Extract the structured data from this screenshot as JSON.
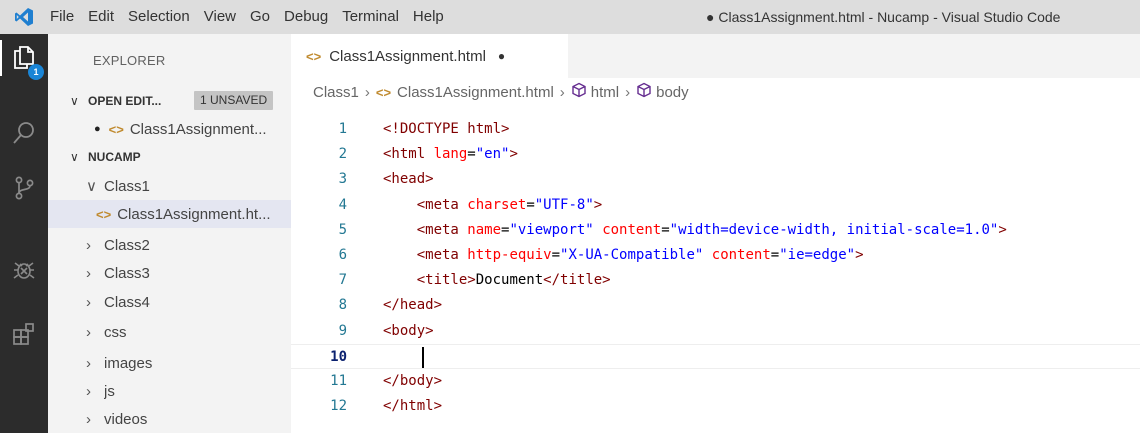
{
  "menu": [
    "File",
    "Edit",
    "Selection",
    "View",
    "Go",
    "Debug",
    "Terminal",
    "Help"
  ],
  "window_title": "● Class1Assignment.html - Nucamp - Visual Studio Code",
  "activity": {
    "explorer_badge": "1"
  },
  "sidebar": {
    "title": "EXPLORER",
    "open_editors": {
      "label": "OPEN EDIT...",
      "badge": "1 UNSAVED",
      "files": [
        {
          "name": "Class1Assignment..."
        }
      ]
    },
    "workspace": {
      "label": "NUCAMP",
      "class1": "Class1",
      "class1_file": "Class1Assignment.ht...",
      "folders": [
        "Class2",
        "Class3",
        "Class4",
        "css",
        "images",
        "js",
        "videos"
      ]
    }
  },
  "editor": {
    "tab_label": "Class1Assignment.html",
    "breadcrumbs": {
      "folder": "Class1",
      "file": "Class1Assignment.html",
      "html": "html",
      "body": "body"
    },
    "active_line": 10,
    "lines": [
      {
        "num": "1",
        "tokens": [
          [
            "t-tag",
            "<!DOCTYPE html>"
          ]
        ]
      },
      {
        "num": "2",
        "tokens": [
          [
            "t-tag",
            "<html "
          ],
          [
            "t-attr",
            "lang"
          ],
          [
            "t-plain",
            "="
          ],
          [
            "t-val",
            "\"en\""
          ],
          [
            "t-tag",
            ">"
          ]
        ]
      },
      {
        "num": "3",
        "tokens": [
          [
            "t-tag",
            "<head>"
          ]
        ]
      },
      {
        "num": "4",
        "tokens": [
          [
            "t-plain",
            "    "
          ],
          [
            "t-tag",
            "<meta "
          ],
          [
            "t-attr",
            "charset"
          ],
          [
            "t-plain",
            "="
          ],
          [
            "t-val",
            "\"UTF-8\""
          ],
          [
            "t-tag",
            ">"
          ]
        ]
      },
      {
        "num": "5",
        "tokens": [
          [
            "t-plain",
            "    "
          ],
          [
            "t-tag",
            "<meta "
          ],
          [
            "t-attr",
            "name"
          ],
          [
            "t-plain",
            "="
          ],
          [
            "t-val",
            "\"viewport\""
          ],
          [
            "t-plain",
            " "
          ],
          [
            "t-attr",
            "content"
          ],
          [
            "t-plain",
            "="
          ],
          [
            "t-val",
            "\"width=device-width, initial-scale=1.0\""
          ],
          [
            "t-tag",
            ">"
          ]
        ]
      },
      {
        "num": "6",
        "tokens": [
          [
            "t-plain",
            "    "
          ],
          [
            "t-tag",
            "<meta "
          ],
          [
            "t-attr",
            "http-equiv"
          ],
          [
            "t-plain",
            "="
          ],
          [
            "t-val",
            "\"X-UA-Compatible\""
          ],
          [
            "t-plain",
            " "
          ],
          [
            "t-attr",
            "content"
          ],
          [
            "t-plain",
            "="
          ],
          [
            "t-val",
            "\"ie=edge\""
          ],
          [
            "t-tag",
            ">"
          ]
        ]
      },
      {
        "num": "7",
        "tokens": [
          [
            "t-plain",
            "    "
          ],
          [
            "t-tag",
            "<title>"
          ],
          [
            "t-plain",
            "Document"
          ],
          [
            "t-tag",
            "</title>"
          ]
        ]
      },
      {
        "num": "8",
        "tokens": [
          [
            "t-tag",
            "</head>"
          ]
        ]
      },
      {
        "num": "9",
        "tokens": [
          [
            "t-tag",
            "<body>"
          ]
        ]
      },
      {
        "num": "10",
        "tokens": []
      },
      {
        "num": "11",
        "tokens": [
          [
            "t-tag",
            "</body>"
          ]
        ]
      },
      {
        "num": "12",
        "tokens": [
          [
            "t-tag",
            "</html>"
          ]
        ]
      }
    ]
  },
  "colors": {
    "titlebar": "#dddddd",
    "activitybar": "#2c2c2c",
    "sidebar": "#f3f3f3",
    "accent_badge": "#1a85d6",
    "html_tag": "#800000",
    "html_attr": "#ff0000",
    "html_value": "#0000ff"
  },
  "icons": {
    "logo": "vscode-logo-icon",
    "explorer": "files-icon",
    "search": "search-icon",
    "scm": "source-control-icon",
    "debug": "debug-icon",
    "extensions": "extensions-icon"
  }
}
